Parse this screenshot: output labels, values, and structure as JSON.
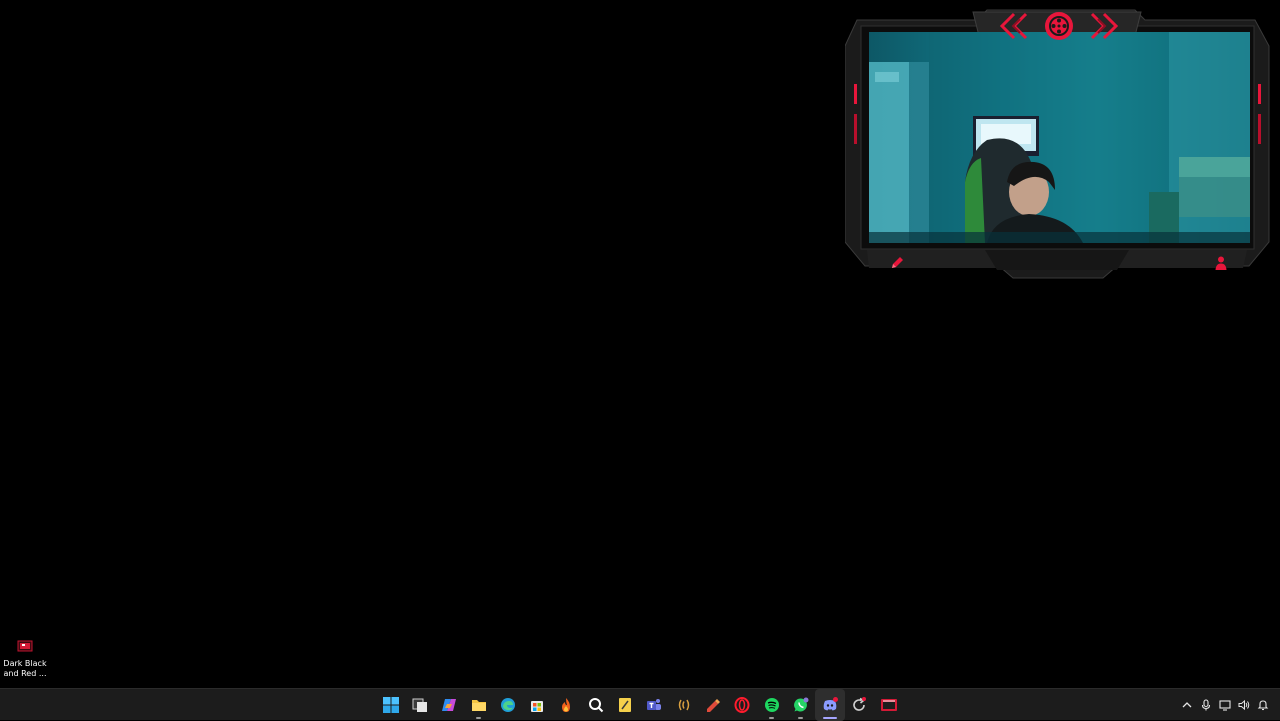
{
  "desktop": {
    "background_color": "#000000",
    "shortcuts": [
      {
        "label": "Dark Black and Red ...",
        "icon": "red-image-file-icon"
      }
    ]
  },
  "webcam_overlay": {
    "frame_accent_color": "#e8163b",
    "frame_color": "#1e1e1e",
    "icons": [
      "chevrons-left-icon",
      "film-reel-icon",
      "chevrons-right-icon",
      "pencil-icon",
      "person-icon"
    ]
  },
  "taskbar": {
    "background_color": "#1c1c1c",
    "apps": [
      {
        "name": "Start",
        "icon": "windows-logo-icon"
      },
      {
        "name": "Task View",
        "icon": "task-view-icon"
      },
      {
        "name": "Copilot",
        "icon": "copilot-icon"
      },
      {
        "name": "File Explorer",
        "icon": "folder-icon"
      },
      {
        "name": "Microsoft Edge",
        "icon": "edge-icon"
      },
      {
        "name": "Microsoft Store",
        "icon": "store-icon"
      },
      {
        "name": "Flame app",
        "icon": "flame-icon"
      },
      {
        "name": "Search app",
        "icon": "search-app-icon"
      },
      {
        "name": "Notes app",
        "icon": "notes-icon"
      },
      {
        "name": "Teams",
        "icon": "teams-icon"
      },
      {
        "name": "Audio app",
        "icon": "audio-waves-icon"
      },
      {
        "name": "Paint app",
        "icon": "paint-icon"
      },
      {
        "name": "Opera",
        "icon": "opera-icon"
      },
      {
        "name": "Spotify",
        "icon": "spotify-icon"
      },
      {
        "name": "WhatsApp",
        "icon": "whatsapp-icon"
      },
      {
        "name": "Discord",
        "icon": "discord-icon"
      },
      {
        "name": "Update app",
        "icon": "refresh-icon"
      },
      {
        "name": "Gallery app",
        "icon": "red-gallery-icon"
      }
    ],
    "tray": [
      {
        "name": "Show hidden icons",
        "icon": "chevron-up-icon"
      },
      {
        "name": "Microphone",
        "icon": "microphone-icon"
      },
      {
        "name": "Display",
        "icon": "display-icon"
      },
      {
        "name": "Volume",
        "icon": "speaker-icon"
      },
      {
        "name": "Notifications",
        "icon": "notification-icon"
      }
    ]
  }
}
